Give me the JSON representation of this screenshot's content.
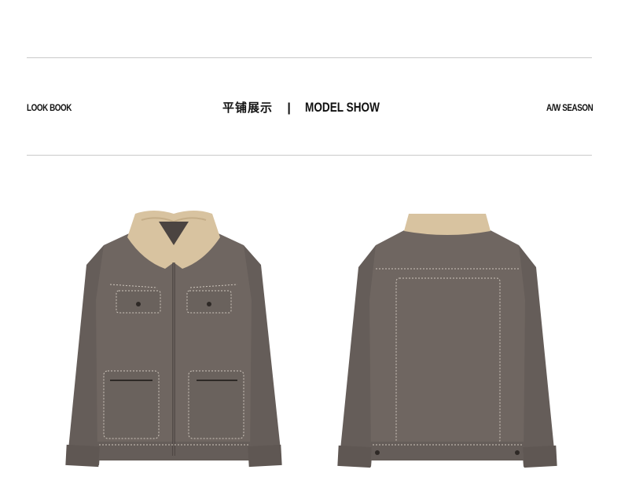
{
  "header": {
    "left_label": "LOOK BOOK",
    "center_cn": "平铺展示",
    "center_separator": "|",
    "center_en": "MODEL SHOW",
    "right_label": "A/W SEASON"
  },
  "colors": {
    "jacket_body": "#6f6661",
    "jacket_shadow": "#5a524e",
    "collar_fleece": "#d8c3a0",
    "stitching": "#cfc7bd",
    "rule": "#c9c9c9"
  },
  "images": [
    {
      "name": "jacket-front-image",
      "depicts": "jacket-front"
    },
    {
      "name": "jacket-back-image",
      "depicts": "jacket-back"
    }
  ]
}
